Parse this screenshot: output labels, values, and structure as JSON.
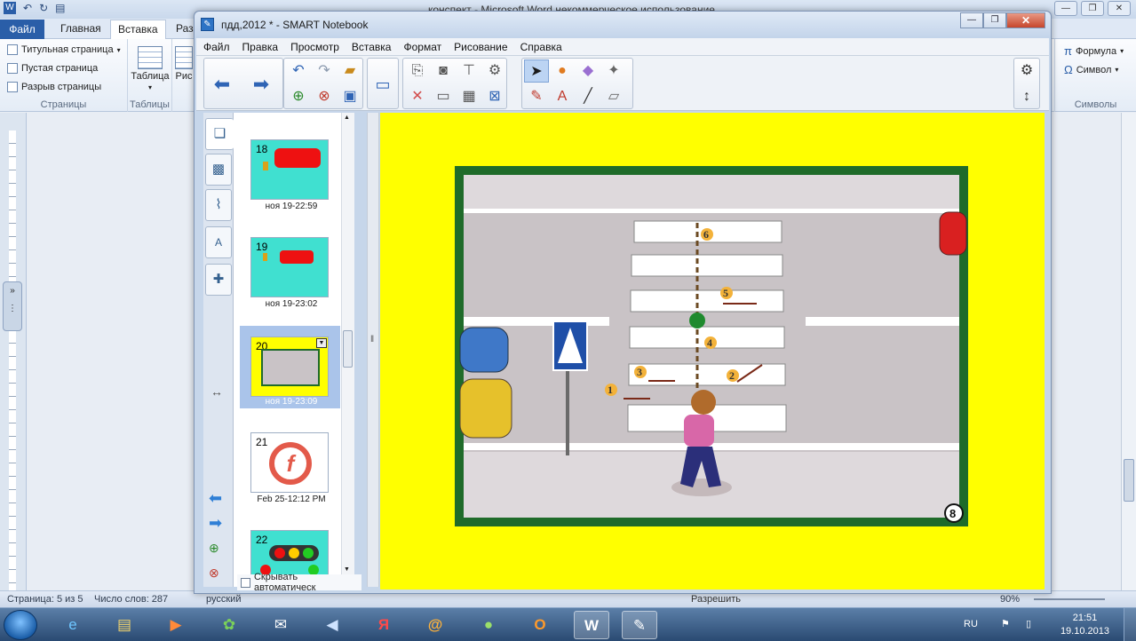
{
  "word": {
    "title": "конспект - Microsoft Word некоммерческое использование",
    "tabs": [
      "Файл",
      "Главная",
      "Вставка",
      "Раз"
    ],
    "active_tab": "Вставка",
    "ribbon": {
      "pages": {
        "items": [
          "Титульная страница",
          "Пустая страница",
          "Разрыв страницы"
        ],
        "label": "Страницы"
      },
      "tables": {
        "button": "Таблица",
        "label": "Таблицы"
      },
      "pic_partial": "Рис",
      "symbols": {
        "formula": "Формула",
        "symbol": "Символ",
        "label": "Символы"
      }
    },
    "status": {
      "page": "Страница: 5 из 5",
      "words": "Число слов: 287",
      "lang": "русский",
      "zoom": "90%"
    },
    "bottom_text": "Разрешить"
  },
  "smart": {
    "title": "пдд,2012 * - SMART Notebook",
    "menu": [
      "Файл",
      "Правка",
      "Просмотр",
      "Вставка",
      "Формат",
      "Рисование",
      "Справка"
    ],
    "slides": [
      {
        "num": "18",
        "caption": "ноя 19-22:59"
      },
      {
        "num": "19",
        "caption": "ноя 19-23:02"
      },
      {
        "num": "20",
        "caption": "ноя 19-23:09"
      },
      {
        "num": "21",
        "caption": "Feb 25-12:12 PM"
      },
      {
        "num": "22",
        "caption": ""
      }
    ],
    "autohide": "Скрывать автоматическ",
    "scene": {
      "step_labels": [
        "1",
        "2",
        "3",
        "4",
        "5",
        "6"
      ],
      "page_number": "8"
    }
  },
  "taskbar": {
    "lang": "RU",
    "time": "21:51",
    "date": "19.10.2013"
  },
  "colors": {
    "canvas": "#ffff00",
    "frame": "#1f6b2a",
    "road": "#bdb7bb",
    "accent": "#2a5ea8"
  }
}
